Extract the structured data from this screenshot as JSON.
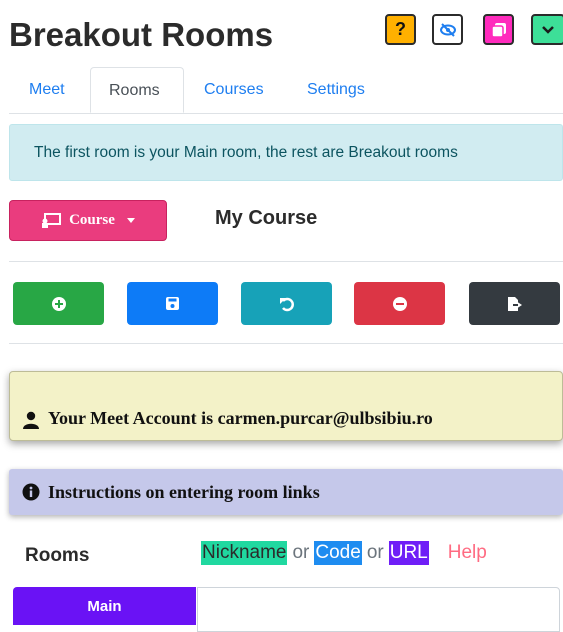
{
  "header": {
    "title": "Breakout Rooms",
    "help_label": "?",
    "colors": {
      "help": "#ffb000",
      "popout": "#ff2bbd",
      "collapse": "#3ddf98"
    }
  },
  "tabs": [
    {
      "label": "Meet",
      "active": false
    },
    {
      "label": "Rooms",
      "active": true
    },
    {
      "label": "Courses",
      "active": false
    },
    {
      "label": "Settings",
      "active": false
    }
  ],
  "banner": {
    "text": "The first room is your Main room, the rest are Breakout rooms"
  },
  "course": {
    "button_label": "Course",
    "button_icon": "chalkboard-icon",
    "current_course": "My Course"
  },
  "actions": [
    {
      "name": "add-room-button",
      "icon": "plus-circle-icon",
      "color": "#28a745"
    },
    {
      "name": "save-button",
      "icon": "floppy-icon",
      "color": "#0d7bf7"
    },
    {
      "name": "undo-button",
      "icon": "undo-icon",
      "color": "#17a2b8"
    },
    {
      "name": "remove-room-button",
      "icon": "minus-circle-icon",
      "color": "#dc3545"
    },
    {
      "name": "export-button",
      "icon": "file-export-icon",
      "color": "#343a40"
    }
  ],
  "account": {
    "text": "Your Meet Account is carmen.purcar@ulbsibiu.ro"
  },
  "instructions": {
    "text": "Instructions on entering room links"
  },
  "rooms": {
    "label": "Rooms",
    "legend": {
      "nickname": "Nickname",
      "or1": "or",
      "code": "Code",
      "or2": "or",
      "url": "URL",
      "help": "Help"
    },
    "items": [
      {
        "label": "Main",
        "value": ""
      }
    ]
  }
}
